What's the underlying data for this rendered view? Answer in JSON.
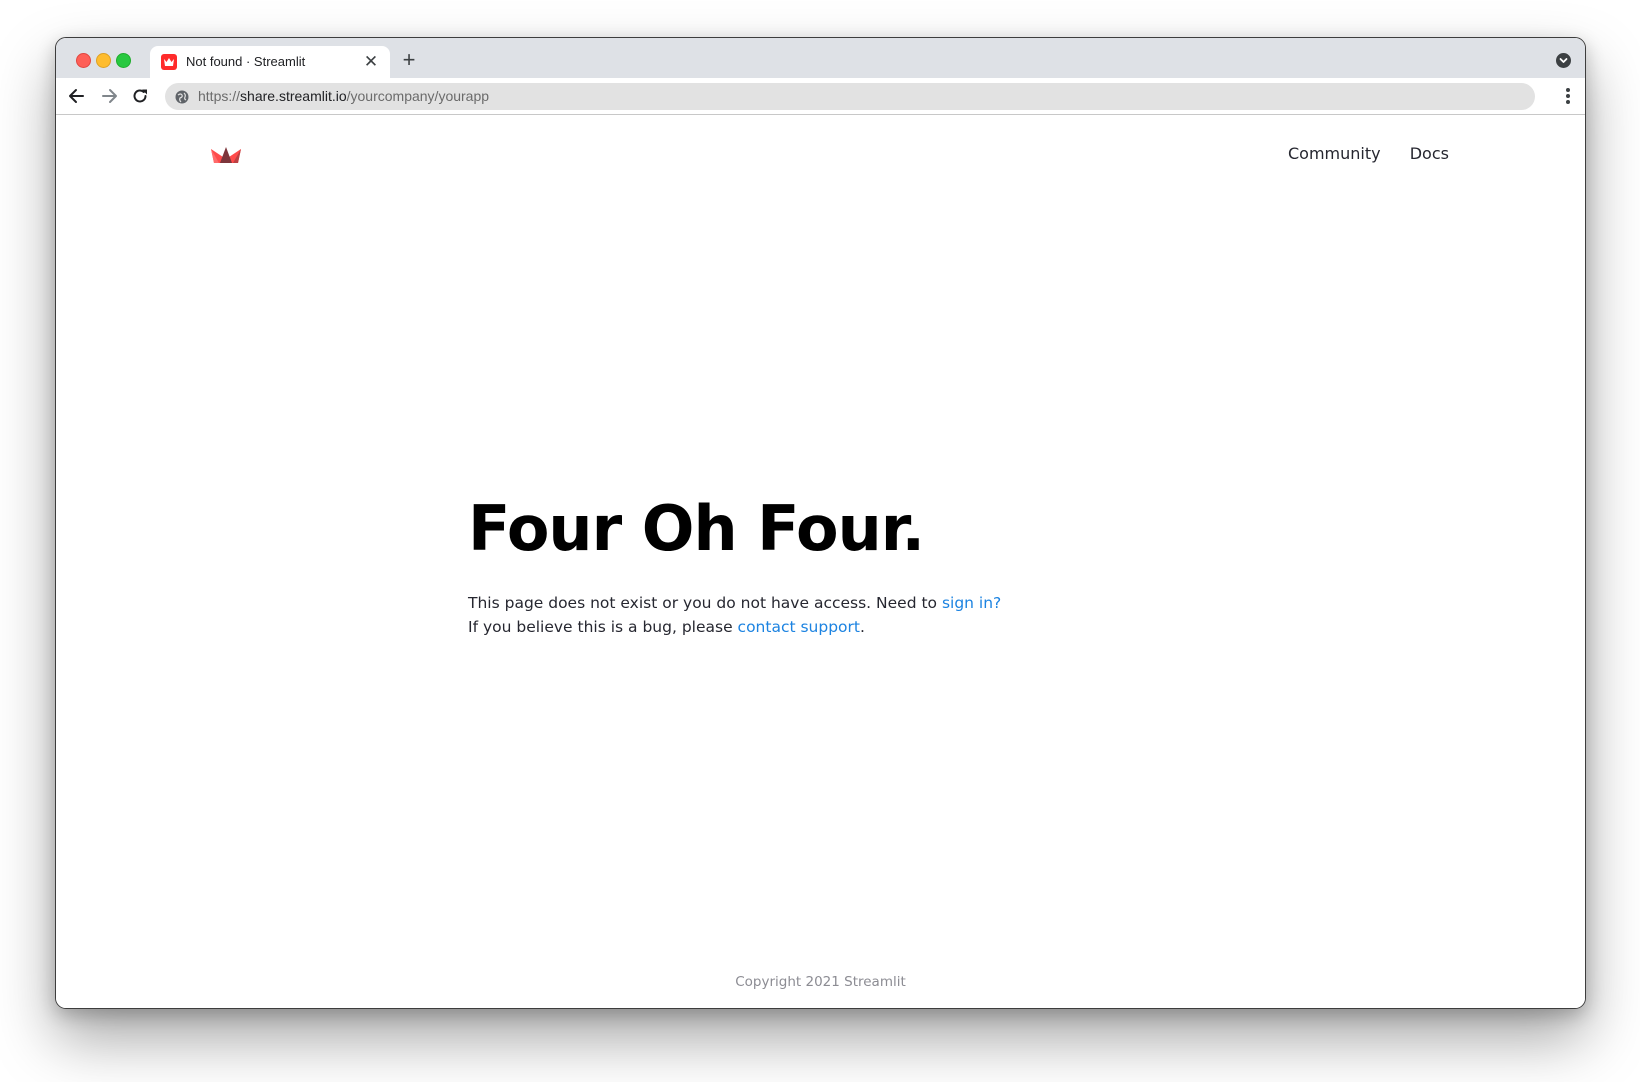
{
  "browser": {
    "tab_title": "Not found · Streamlit",
    "tab_close_glyph": "✕",
    "new_tab_glyph": "+",
    "url_scheme": "https://",
    "url_host": "share.streamlit.io",
    "url_path": "/yourcompany/yourapp",
    "icons": {
      "window_close": "window-close-icon",
      "window_minimize": "window-minimize-icon",
      "window_zoom": "window-zoom-icon",
      "favicon": "streamlit-favicon-icon",
      "back": "back-arrow-icon",
      "forward": "forward-arrow-icon",
      "reload": "reload-icon",
      "site_info": "globe-icon",
      "tab_search": "tab-search-icon",
      "menu": "kebab-menu-icon"
    }
  },
  "header": {
    "logo_icon": "streamlit-crown-logo",
    "nav": [
      {
        "label": "Community"
      },
      {
        "label": "Docs"
      }
    ]
  },
  "main": {
    "headline": "Four Oh Four.",
    "line1_text": "This page does not exist or you do not have access. Need to ",
    "line1_link": "sign in?",
    "line2_text": "If you believe this is a bug, please ",
    "line2_link": "contact support",
    "line2_end": "."
  },
  "footer": {
    "copyright": "Copyright 2021 Streamlit"
  },
  "colors": {
    "brand_red": "#ff4b4b",
    "link_blue": "#1c83e1",
    "text_dark": "#262730",
    "footer_gray": "#8c8c93",
    "tabstrip_bg": "#dee1e6"
  }
}
